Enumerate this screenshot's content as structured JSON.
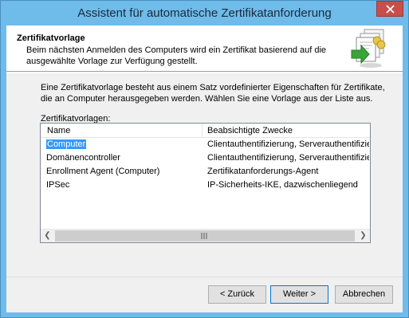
{
  "window": {
    "title": "Assistent für automatische Zertifikatanforderung"
  },
  "header": {
    "title": "Zertifikatvorlage",
    "description": "Beim nächsten Anmelden des Computers wird ein Zertifikat basierend auf die ausgewählte Vorlage zur Verfügung gestellt.",
    "icon": "certificate-stack-icon"
  },
  "intro_text": "Eine Zertifikatvorlage besteht aus einem Satz vordefinierter Eigenschaften für Zertifikate, die an Computer herausgegeben werden. Wählen Sie eine Vorlage aus der Liste aus.",
  "list_label": "Zertifikatvorlagen:",
  "table": {
    "columns": [
      "Name",
      "Beabsichtigte Zwecke"
    ],
    "rows": [
      {
        "name": "Computer",
        "purpose": "Clientauthentifizierung, Serverauthentifizieru",
        "selected": true
      },
      {
        "name": "Domänencontroller",
        "purpose": "Clientauthentifizierung, Serverauthentifizieru",
        "selected": false
      },
      {
        "name": "Enrollment Agent (Computer)",
        "purpose": "Zertifikatanforderungs-Agent",
        "selected": false
      },
      {
        "name": "IPSec",
        "purpose": "IP-Sicherheits-IKE, dazwischenliegend",
        "selected": false
      }
    ]
  },
  "buttons": {
    "back": "< Zurück",
    "next": "Weiter >",
    "cancel": "Abbrechen"
  },
  "colors": {
    "title_bar": "#6fbbe9",
    "close_button": "#c74f4b",
    "selection": "#3399ff"
  }
}
